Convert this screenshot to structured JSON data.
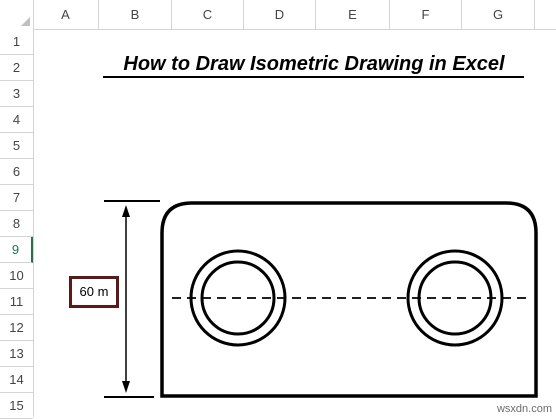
{
  "spreadsheet": {
    "columns": [
      "A",
      "B",
      "C",
      "D",
      "E",
      "F",
      "G"
    ],
    "rows": [
      "1",
      "2",
      "3",
      "4",
      "5",
      "6",
      "7",
      "8",
      "9",
      "10",
      "11",
      "12",
      "13",
      "14",
      "15"
    ],
    "selected_row": "9"
  },
  "title": "How to Draw Isometric Drawing in Excel",
  "dimension_label": "60 m",
  "watermark": "wsxdn.com",
  "colors": {
    "selection_accent": "#217346",
    "dimension_box_border": "#5b1a1a",
    "gridline": "#d4d4d4"
  }
}
